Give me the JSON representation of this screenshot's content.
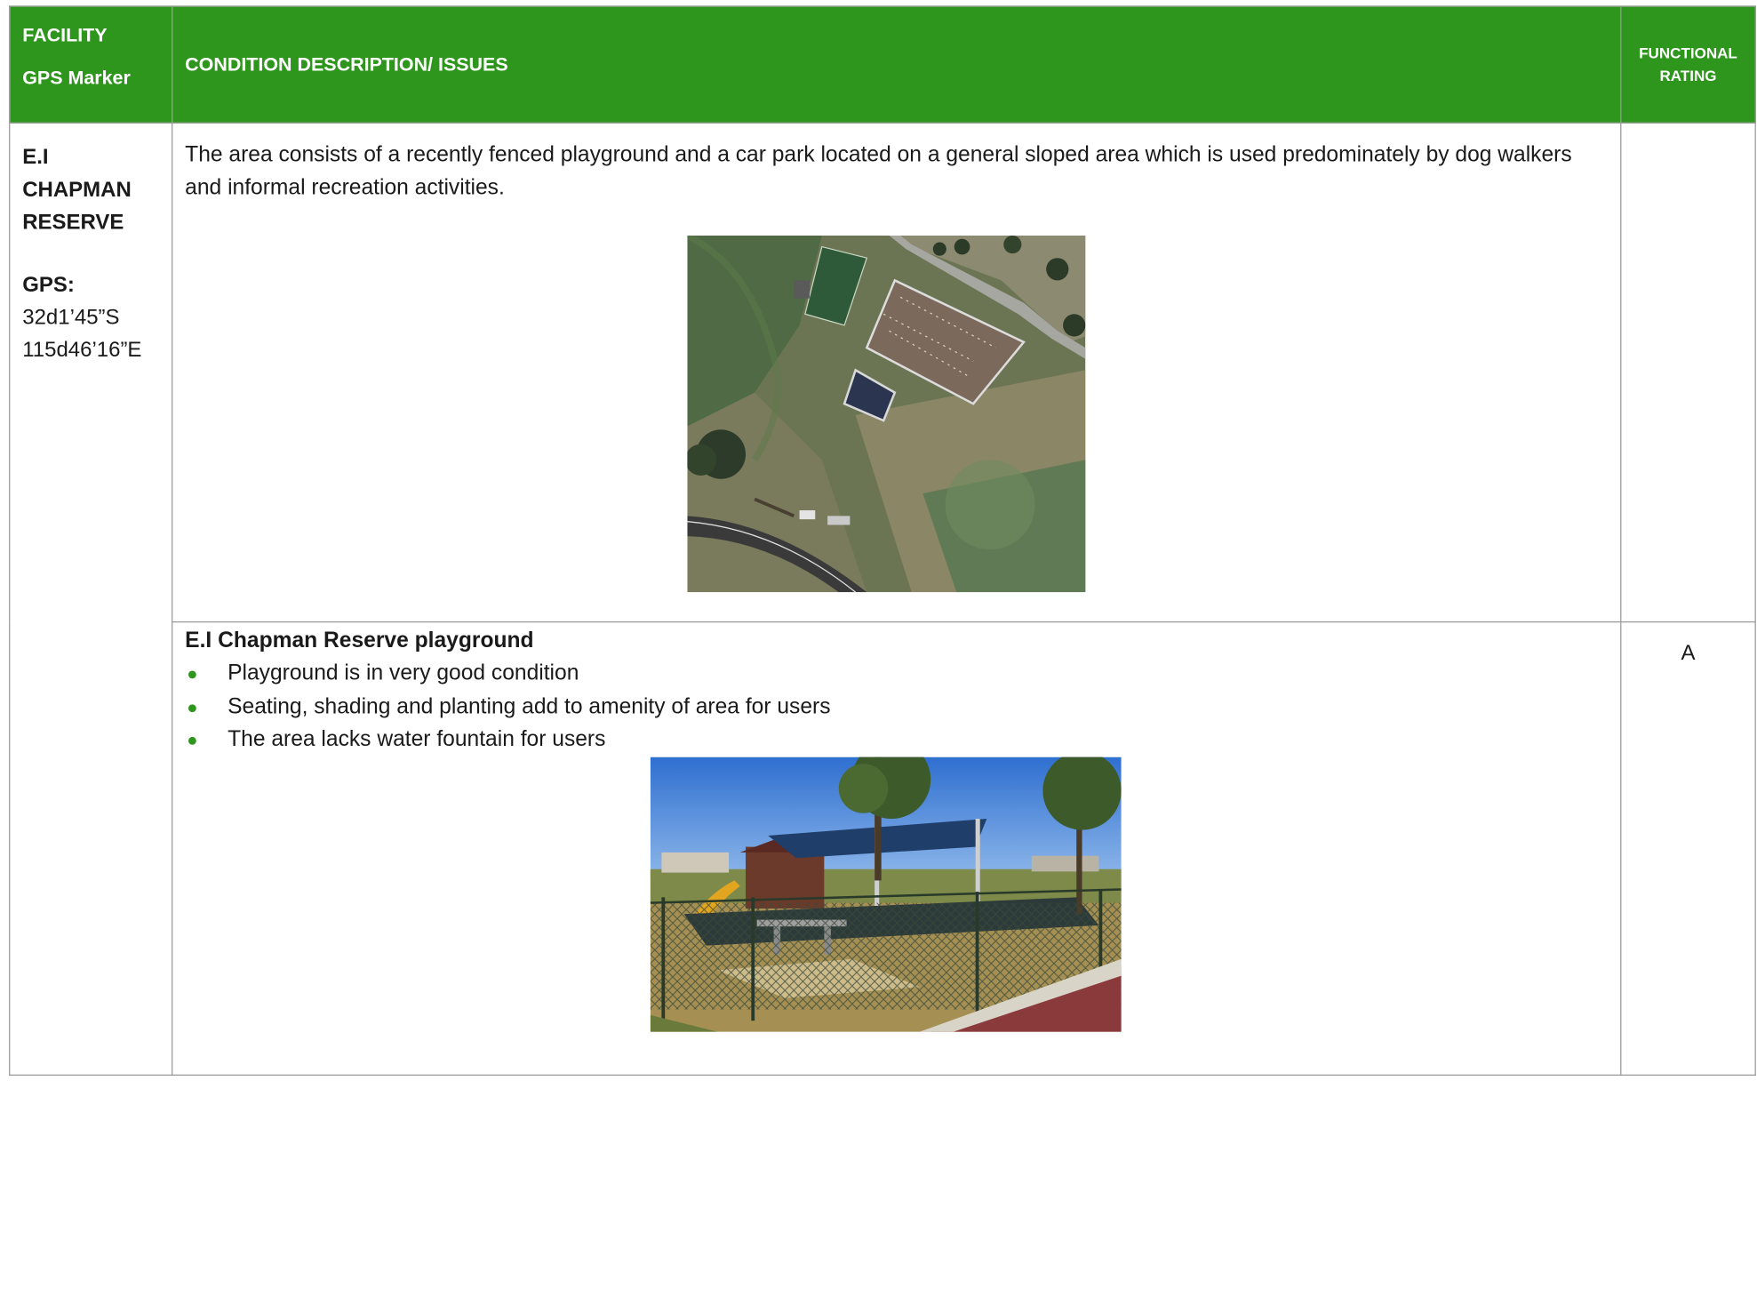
{
  "header": {
    "facility_line1": "FACILITY",
    "facility_line2": "GPS Marker",
    "condition": "CONDITION DESCRIPTION/ ISSUES",
    "rating_line1": "FUNCTIONAL",
    "rating_line2": "RATING"
  },
  "facility": {
    "name_line1": "E.I",
    "name_line2": "CHAPMAN",
    "name_line3": "RESERVE",
    "gps_label": "GPS:",
    "lat": "32d1’45”S",
    "lon": "115d46’16”E"
  },
  "overview": {
    "text": "The area consists of a recently fenced playground and a car park located on a general sloped area which is used predominately by dog walkers and informal recreation activities.",
    "rating": ""
  },
  "playground": {
    "title": "E.I Chapman Reserve playground",
    "issues": [
      "Playground is in very good condition",
      "Seating, shading and planting add to amenity of area for users",
      "The area lacks water fountain for users"
    ],
    "rating": "A"
  },
  "colors": {
    "header_green": "#2e961c",
    "border_grey": "#9a9a9a",
    "bullet_green": "#2e961c"
  }
}
